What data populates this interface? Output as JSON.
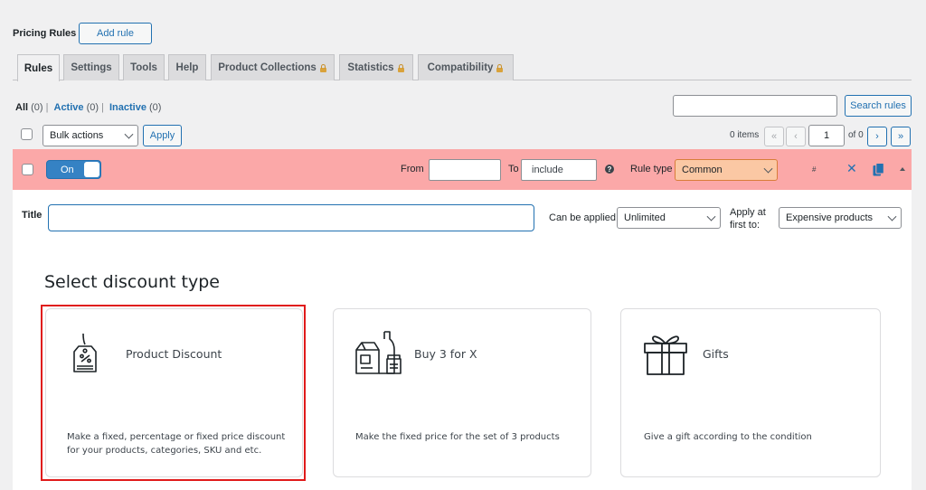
{
  "header": {
    "title": "Pricing Rules",
    "add_rule": "Add rule"
  },
  "tabs": [
    {
      "label": "Rules",
      "active": true,
      "locked": false
    },
    {
      "label": "Settings",
      "active": false,
      "locked": false
    },
    {
      "label": "Tools",
      "active": false,
      "locked": false
    },
    {
      "label": "Help",
      "active": false,
      "locked": false
    },
    {
      "label": "Product Collections",
      "active": false,
      "locked": true
    },
    {
      "label": "Statistics",
      "active": false,
      "locked": true
    },
    {
      "label": "Compatibility",
      "active": false,
      "locked": true
    }
  ],
  "filters": {
    "all": "All",
    "all_count": "(0)",
    "active": "Active",
    "active_count": "(0)",
    "inactive": "Inactive",
    "inactive_count": "(0)"
  },
  "search": {
    "value": "",
    "button": "Search rules"
  },
  "bulk": {
    "selected": "Bulk actions",
    "apply": "Apply"
  },
  "pagination": {
    "items": "0 items",
    "first": "«",
    "prev": "‹",
    "current": "1",
    "of": "of 0",
    "next": "›",
    "last": "»"
  },
  "rule": {
    "toggle": "On",
    "from_label": "From",
    "from_value": "",
    "to_label": "To",
    "to_value": "include",
    "info": "?",
    "type_label": "Rule type",
    "type_value": "Common",
    "hash": "#",
    "close": "✕",
    "title_label": "Title",
    "title_value": "",
    "can_apply_label": "Can be applied",
    "can_apply_value": "Unlimited",
    "apply_first_label_1": "Apply at",
    "apply_first_label_2": "first to:",
    "apply_first_value": "Expensive products"
  },
  "discount_section": {
    "title": "Select discount type",
    "cards": [
      {
        "name": "Product Discount",
        "icon": "price-tag-icon",
        "desc_1": "Make a fixed, percentage or fixed price discount",
        "desc_2": "for your products, categories, SKU and etc."
      },
      {
        "name": "Buy 3 for X",
        "icon": "grocery-bottles-icon",
        "desc_1": "Make the fixed price for the set of 3 products",
        "desc_2": ""
      },
      {
        "name": "Gifts",
        "icon": "gift-box-icon",
        "desc_1": "Give a gift according to the condition",
        "desc_2": ""
      }
    ]
  },
  "colors": {
    "accent": "#2271b1",
    "rule_bar": "#fba8a8",
    "rule_type_bg": "#fbc8a4",
    "highlight": "#e01b1b"
  }
}
